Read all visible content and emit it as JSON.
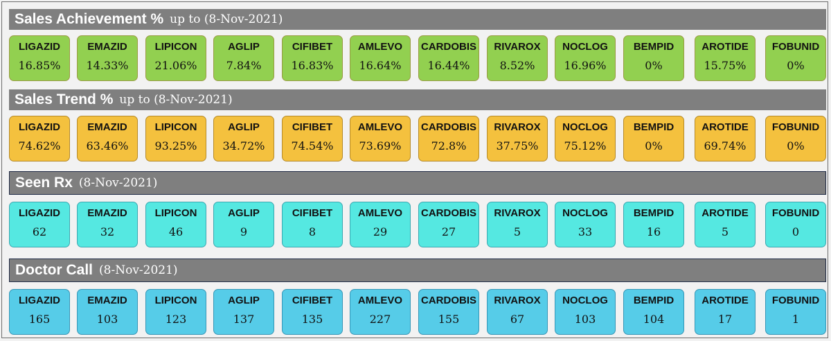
{
  "sections": [
    {
      "title": "Sales Achievement %",
      "subtitle": "up to (8-Nov-2021)",
      "items": [
        {
          "name": "LIGAZID",
          "value": "16.85%"
        },
        {
          "name": "EMAZID",
          "value": "14.33%"
        },
        {
          "name": "LIPICON",
          "value": "21.06%"
        },
        {
          "name": "AGLIP",
          "value": "7.84%"
        },
        {
          "name": "CIFIBET",
          "value": "16.83%"
        },
        {
          "name": "AMLEVO",
          "value": "16.64%"
        },
        {
          "name": "CARDOBIS",
          "value": "16.44%"
        },
        {
          "name": "RIVAROX",
          "value": "8.52%"
        },
        {
          "name": "NOCLOG",
          "value": "16.96%"
        },
        {
          "name": "BEMPID",
          "value": "0%"
        },
        {
          "name": "AROTIDE",
          "value": "15.75%"
        },
        {
          "name": "FOBUNID",
          "value": "0%"
        }
      ]
    },
    {
      "title": "Sales Trend %",
      "subtitle": "up to (8-Nov-2021)",
      "items": [
        {
          "name": "LIGAZID",
          "value": "74.62%"
        },
        {
          "name": "EMAZID",
          "value": "63.46%"
        },
        {
          "name": "LIPICON",
          "value": "93.25%"
        },
        {
          "name": "AGLIP",
          "value": "34.72%"
        },
        {
          "name": "CIFIBET",
          "value": "74.54%"
        },
        {
          "name": "AMLEVO",
          "value": "73.69%"
        },
        {
          "name": "CARDOBIS",
          "value": "72.8%"
        },
        {
          "name": "RIVAROX",
          "value": "37.75%"
        },
        {
          "name": "NOCLOG",
          "value": "75.12%"
        },
        {
          "name": "BEMPID",
          "value": "0%"
        },
        {
          "name": "AROTIDE",
          "value": "69.74%"
        },
        {
          "name": "FOBUNID",
          "value": "0%"
        }
      ]
    },
    {
      "title": "Seen Rx",
      "subtitle": "(8-Nov-2021)",
      "items": [
        {
          "name": "LIGAZID",
          "value": "62"
        },
        {
          "name": "EMAZID",
          "value": "32"
        },
        {
          "name": "LIPICON",
          "value": "46"
        },
        {
          "name": "AGLIP",
          "value": "9"
        },
        {
          "name": "CIFIBET",
          "value": "8"
        },
        {
          "name": "AMLEVO",
          "value": "29"
        },
        {
          "name": "CARDOBIS",
          "value": "27"
        },
        {
          "name": "RIVAROX",
          "value": "5"
        },
        {
          "name": "NOCLOG",
          "value": "33"
        },
        {
          "name": "BEMPID",
          "value": "16"
        },
        {
          "name": "AROTIDE",
          "value": "5"
        },
        {
          "name": "FOBUNID",
          "value": "0"
        }
      ]
    },
    {
      "title": "Doctor Call",
      "subtitle": "(8-Nov-2021)",
      "items": [
        {
          "name": "LIGAZID",
          "value": "165"
        },
        {
          "name": "EMAZID",
          "value": "103"
        },
        {
          "name": "LIPICON",
          "value": "123"
        },
        {
          "name": "AGLIP",
          "value": "137"
        },
        {
          "name": "CIFIBET",
          "value": "135"
        },
        {
          "name": "AMLEVO",
          "value": "227"
        },
        {
          "name": "CARDOBIS",
          "value": "155"
        },
        {
          "name": "RIVAROX",
          "value": "67"
        },
        {
          "name": "NOCLOG",
          "value": "103"
        },
        {
          "name": "BEMPID",
          "value": "104"
        },
        {
          "name": "AROTIDE",
          "value": "17"
        },
        {
          "name": "FOBUNID",
          "value": "1"
        }
      ]
    }
  ],
  "colors": {
    "header_bar": "#7f7f7f",
    "sales_achievement_tile": "#92d050",
    "sales_trend_tile": "#f4c13e",
    "seen_rx_tile": "#55e8e1",
    "doctor_call_tile": "#56cce8"
  }
}
